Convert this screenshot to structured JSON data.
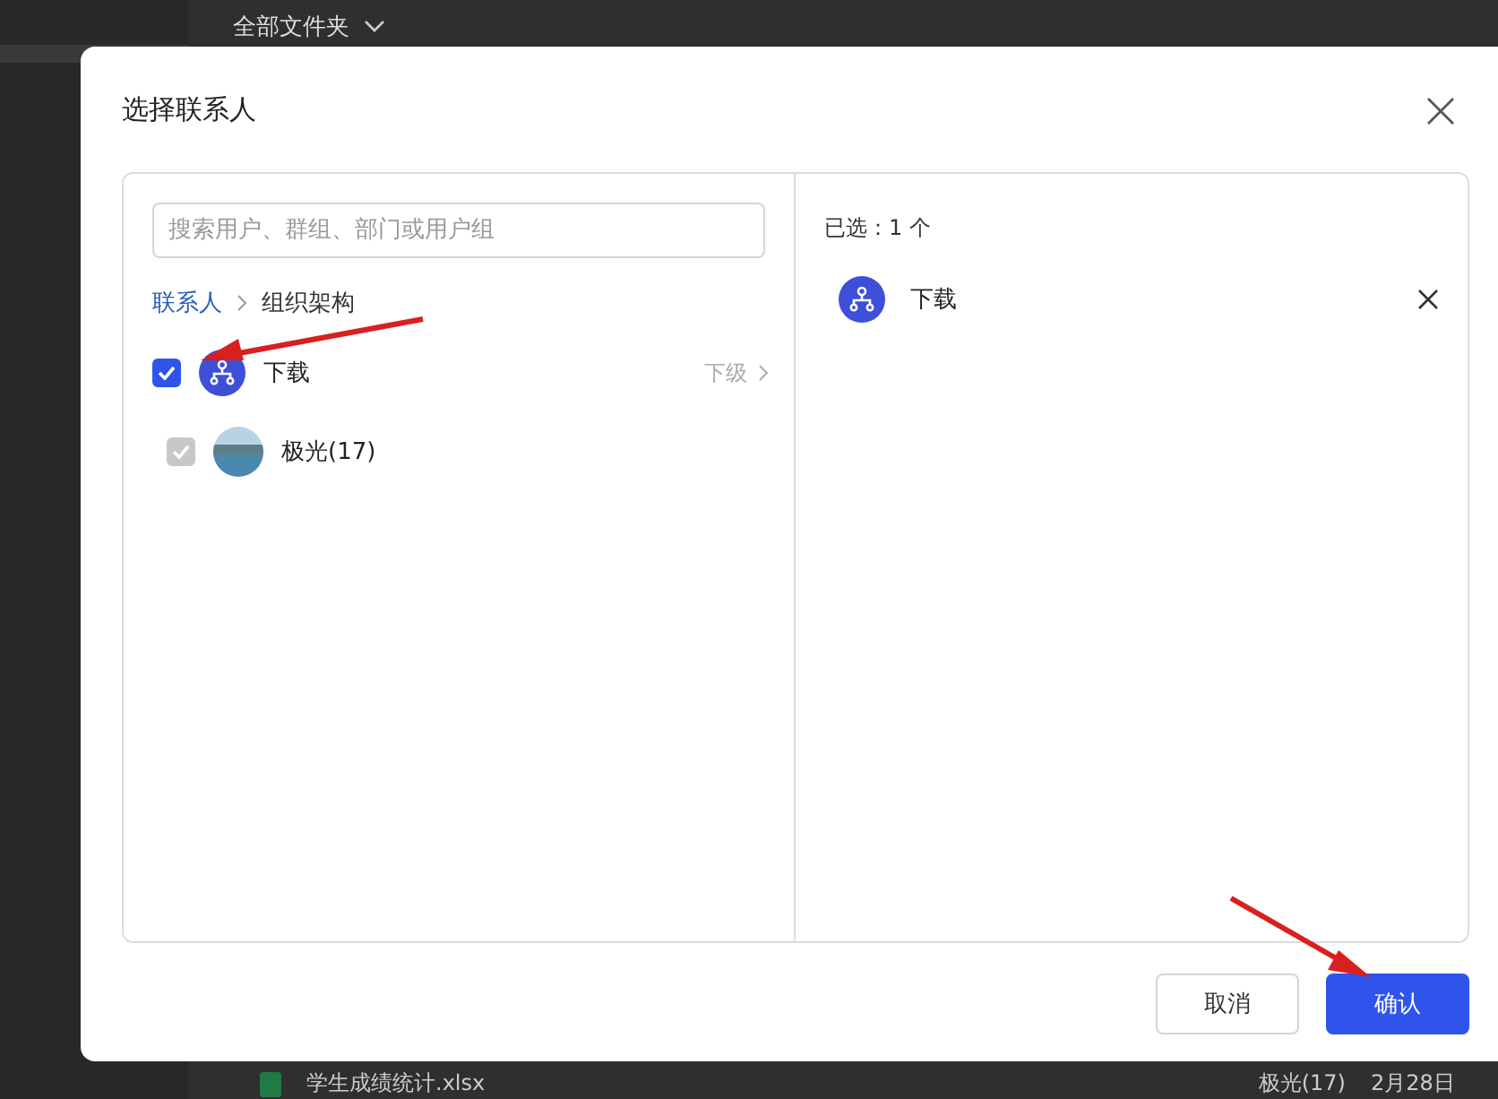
{
  "background": {
    "folder_title": "全部文件夹",
    "file_row": {
      "name": "学生成绩统计.xlsx",
      "owner": "极光(17)",
      "date": "2月28日"
    }
  },
  "dialog": {
    "title": "选择联系人",
    "search": {
      "placeholder": "搜索用户、群组、部门或用户组"
    },
    "breadcrumb": [
      {
        "label": "联系人",
        "link": true
      },
      {
        "label": "组织架构",
        "link": false
      }
    ],
    "items": [
      {
        "name": "下载",
        "kind": "org",
        "checked": true,
        "disabled": false,
        "sub_label": "下级"
      },
      {
        "name": "极光(17)",
        "kind": "photo",
        "checked": true,
        "disabled": true
      }
    ],
    "selected_count": "已选：1 个",
    "selected_items": [
      {
        "name": "下载",
        "kind": "org"
      }
    ],
    "buttons": [
      {
        "label": "取消",
        "kind": "secondary"
      },
      {
        "label": "确认",
        "kind": "primary"
      }
    ]
  }
}
